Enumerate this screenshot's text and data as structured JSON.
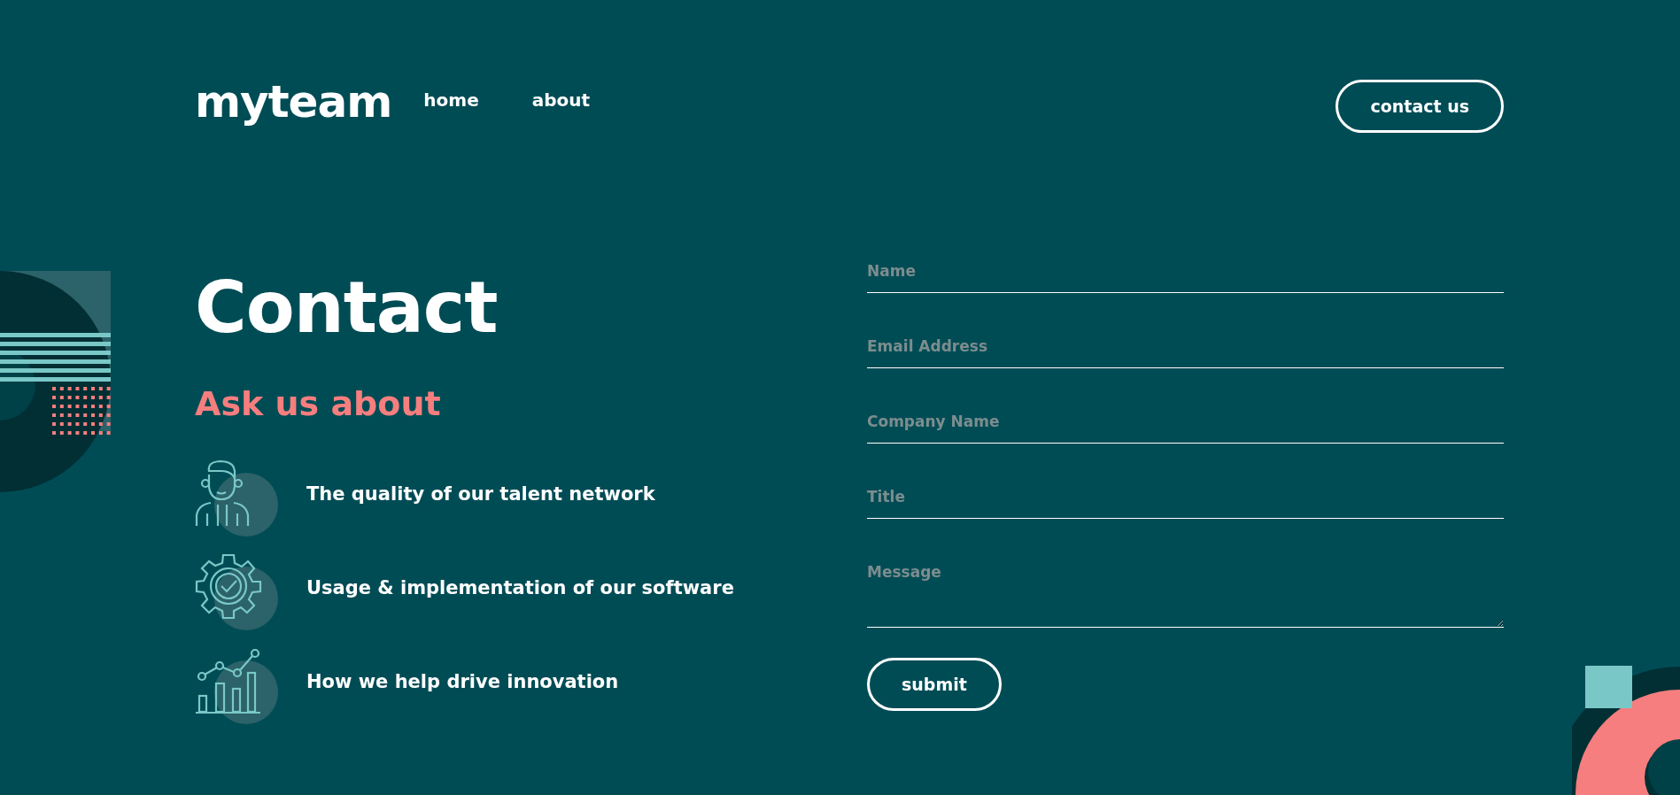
{
  "header": {
    "logo": "myteam",
    "nav": [
      {
        "label": "home"
      },
      {
        "label": "about"
      }
    ],
    "cta": "contact us"
  },
  "heading": "Contact",
  "subheading": "Ask us about",
  "topics": [
    {
      "kind": "person",
      "text": "The quality of our talent network"
    },
    {
      "kind": "gear",
      "text": "Usage & implementation of our software"
    },
    {
      "kind": "chart",
      "text": "How we help drive innovation"
    }
  ],
  "form": {
    "fields": [
      {
        "kind": "input",
        "placeholder": "Name"
      },
      {
        "kind": "input",
        "placeholder": "Email Address"
      },
      {
        "kind": "input",
        "placeholder": "Company Name"
      },
      {
        "kind": "input",
        "placeholder": "Title"
      },
      {
        "kind": "textarea",
        "placeholder": "Message"
      }
    ],
    "submit": "submit"
  }
}
